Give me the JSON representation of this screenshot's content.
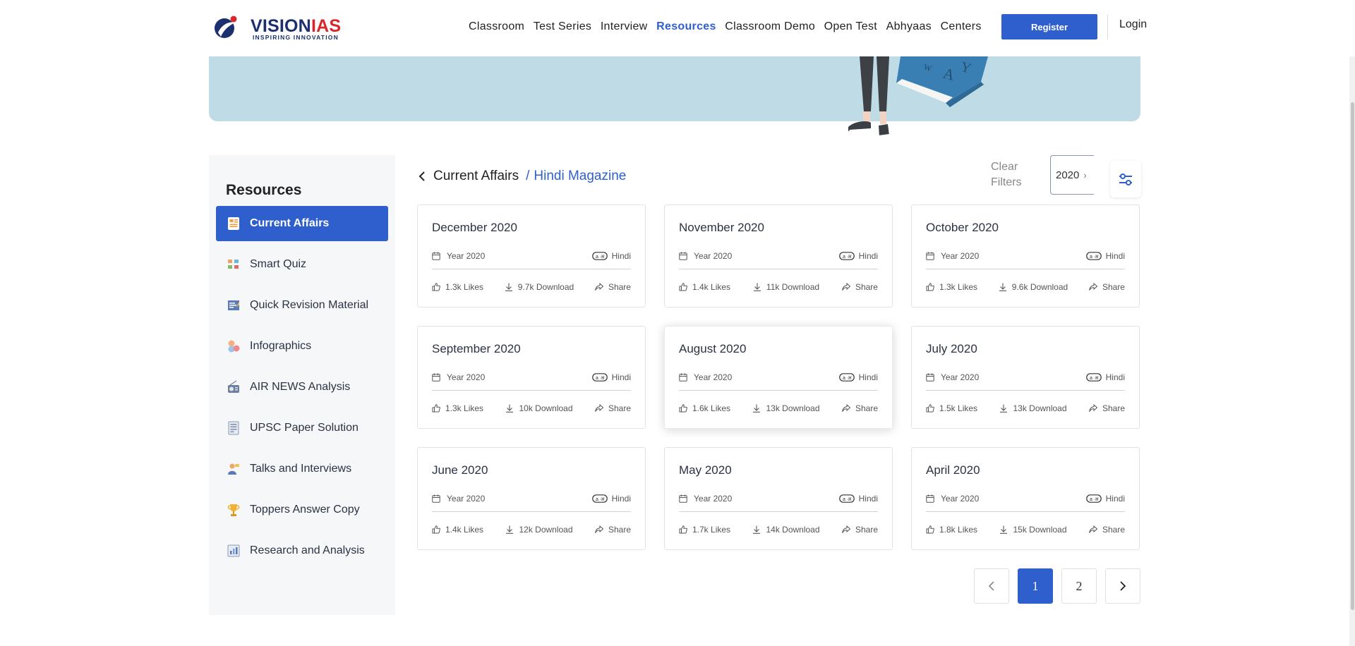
{
  "header": {
    "logo": {
      "brand_a": "VISION",
      "brand_b": "IAS",
      "tagline": "INSPIRING INNOVATION"
    },
    "nav": [
      {
        "label": "Classroom",
        "active": false
      },
      {
        "label": "Test Series",
        "active": false
      },
      {
        "label": "Interview",
        "active": false
      },
      {
        "label": "Resources",
        "active": true
      },
      {
        "label": "Classroom Demo",
        "active": false
      },
      {
        "label": "Open Test",
        "active": false
      },
      {
        "label": "Abhyaas",
        "active": false
      },
      {
        "label": "Centers",
        "active": false
      }
    ],
    "register_label": "Register",
    "login_label": "Login"
  },
  "sidebar": {
    "title": "Resources",
    "items": [
      {
        "label": "Current Affairs",
        "icon": "newspaper-icon",
        "active": true
      },
      {
        "label": "Smart Quiz",
        "icon": "quiz-icon",
        "active": false
      },
      {
        "label": "Quick Revision Material",
        "icon": "revision-icon",
        "active": false
      },
      {
        "label": "Infographics",
        "icon": "infographics-icon",
        "active": false
      },
      {
        "label": "AIR NEWS Analysis",
        "icon": "radio-icon",
        "active": false
      },
      {
        "label": "UPSC Paper Solution",
        "icon": "paper-icon",
        "active": false
      },
      {
        "label": "Talks and Interviews",
        "icon": "interview-icon",
        "active": false
      },
      {
        "label": "Toppers Answer Copy",
        "icon": "trophy-icon",
        "active": false
      },
      {
        "label": "Research and Analysis",
        "icon": "research-icon",
        "active": false
      }
    ]
  },
  "breadcrumb": {
    "parent": "Current Affairs",
    "separator": "/",
    "current": "Hindi Magazine"
  },
  "filters": {
    "clear_label": "Clear Filters",
    "year_value": "2020"
  },
  "cards": [
    {
      "title": "December 2020",
      "year": "Year 2020",
      "lang": "Hindi",
      "likes": "1.3k Likes",
      "downloads": "9.7k Download",
      "share": "Share"
    },
    {
      "title": "November 2020",
      "year": "Year 2020",
      "lang": "Hindi",
      "likes": "1.4k Likes",
      "downloads": "11k Download",
      "share": "Share"
    },
    {
      "title": "October 2020",
      "year": "Year 2020",
      "lang": "Hindi",
      "likes": "1.3k Likes",
      "downloads": "9.6k Download",
      "share": "Share"
    },
    {
      "title": "September 2020",
      "year": "Year 2020",
      "lang": "Hindi",
      "likes": "1.3k Likes",
      "downloads": "10k Download",
      "share": "Share"
    },
    {
      "title": "August 2020",
      "year": "Year 2020",
      "lang": "Hindi",
      "likes": "1.6k Likes",
      "downloads": "13k Download",
      "share": "Share"
    },
    {
      "title": "July 2020",
      "year": "Year 2020",
      "lang": "Hindi",
      "likes": "1.5k Likes",
      "downloads": "13k Download",
      "share": "Share"
    },
    {
      "title": "June 2020",
      "year": "Year 2020",
      "lang": "Hindi",
      "likes": "1.4k Likes",
      "downloads": "12k Download",
      "share": "Share"
    },
    {
      "title": "May 2020",
      "year": "Year 2020",
      "lang": "Hindi",
      "likes": "1.7k Likes",
      "downloads": "14k Download",
      "share": "Share"
    },
    {
      "title": "April 2020",
      "year": "Year 2020",
      "lang": "Hindi",
      "likes": "1.8k Likes",
      "downloads": "15k Download",
      "share": "Share"
    }
  ],
  "pagination": {
    "pages": [
      "1",
      "2"
    ],
    "current": "1"
  },
  "colors": {
    "primary": "#2f5fcc",
    "banner": "#bedbe6",
    "sidebar_bg": "#f6f7f9",
    "brand_red": "#d8262b",
    "brand_navy": "#1c2f6e"
  }
}
